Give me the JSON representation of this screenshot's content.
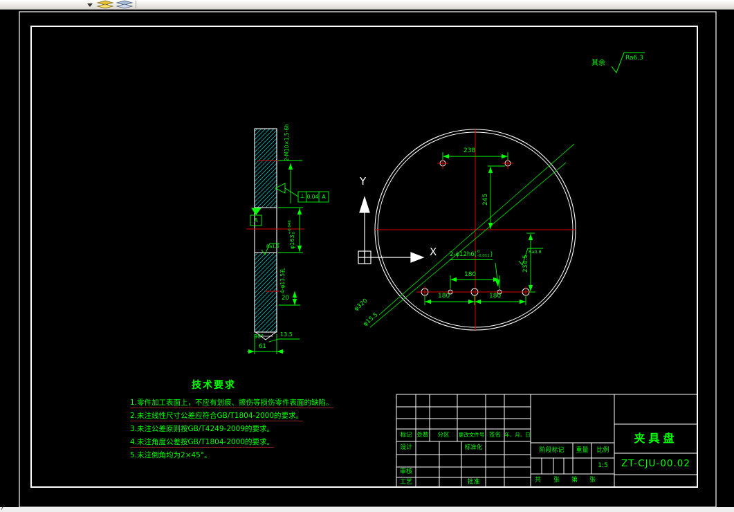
{
  "window": {
    "toolbar": {
      "icons": [
        "dropdown-arrow",
        "layers-yellow",
        "layers-blue"
      ]
    },
    "statusbar": {
      "mark": "/"
    }
  },
  "roughness_note": {
    "prefix": "其余",
    "value": "Ra6.3"
  },
  "section_view": {
    "thread_label": "2-M10×1.5-6h",
    "tolerance_frame": {
      "symbol": "⊥",
      "value": "0.04",
      "datum": "A"
    },
    "datum_label": "A",
    "bore_dim": {
      "nominal": "φ163",
      "upper": "+0.046",
      "lower": "0"
    },
    "bore_roughness": "Ra1.6",
    "hole_label": "4-φ13.5孔",
    "depth_dim": "20",
    "csk_angle": "90°",
    "csk_depth": "13.5",
    "width_dim": "61"
  },
  "circle_view": {
    "dim_top": "238",
    "dim_vertical": "245",
    "dim_mid": "180",
    "dim_bottom_left": "180",
    "dim_bottom_right": "180",
    "dim_right": "234.5",
    "bolt_circle": "φ320",
    "hole_dia": "φ15.5",
    "pin_label": {
      "prefix": "2-φ12h6(",
      "upper": "0",
      "lower": "-0.011",
      "suffix": ")"
    },
    "pin_roughness": "Ra0.8",
    "axis_x": "X",
    "axis_y": "Y"
  },
  "tech_requirements": {
    "title": "技术要求",
    "items": [
      {
        "text": "1.零件加工表面上，不应有划痕、擦伤等损伤零件表面的缺陷。"
      },
      {
        "text": "2.未注线性尺寸公差应符合GB/T1804-2000的要求。"
      },
      {
        "text": "3.未注公差原则按GB/T4249-2009的要求。"
      },
      {
        "text": "4.未注角度公差按GB/T1804-2000的要求。"
      },
      {
        "text": "5.未注倒角均为2×45°。"
      }
    ]
  },
  "title_block": {
    "revision_headers": [
      "标记",
      "处数",
      "分区",
      "更改文件号",
      "签名",
      "年、月、日"
    ],
    "design_label": "设计",
    "standardization_label": "标准化",
    "review_label": "审核",
    "process_label": "工艺",
    "approve_label": "批准",
    "stage_label": "阶段标记",
    "weight_label": "重量",
    "scale_label": "比例",
    "scale_value": "1:5",
    "sheets_row": [
      "共",
      "张",
      "第",
      "张"
    ],
    "part_name": "夹具盘",
    "drawing_number": "ZT-CJU-00.02"
  },
  "colors": {
    "annotation_green": "#00ff00",
    "centerline_red": "#e00000",
    "hatch_cyan": "#00b4b4",
    "drawing_white": "#ffffff",
    "background": "#000000"
  }
}
